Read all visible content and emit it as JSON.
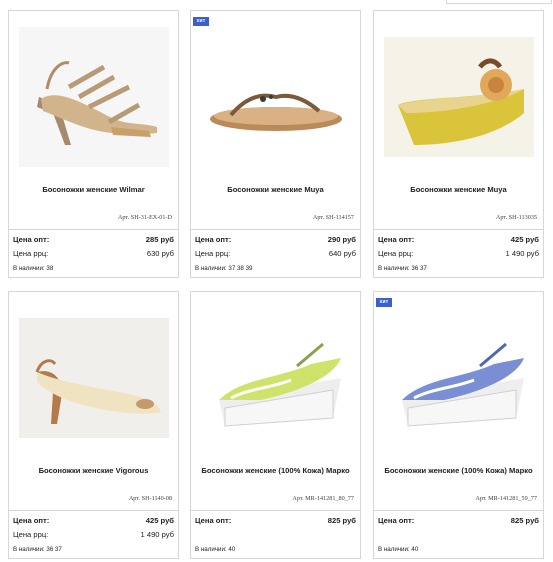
{
  "products": [
    {
      "badge": "",
      "title": "Босоножки женские Wilmar",
      "sku": "Арт. SH-31-EX-01-D",
      "price_opt_label": "Цена опт:",
      "price_opt": "285 руб",
      "price_rrc_label": "Цена ррц:",
      "price_rrc": "630 руб",
      "stock_label": "В наличии:",
      "stock": "38"
    },
    {
      "badge": "хит",
      "title": "Босоножки женские Muya",
      "sku": "Арт. SH-114157",
      "price_opt_label": "Цена опт:",
      "price_opt": "290 руб",
      "price_rrc_label": "Цена ррц:",
      "price_rrc": "640 руб",
      "stock_label": "В наличии:",
      "stock": "37 38 39"
    },
    {
      "badge": "",
      "title": "Босоножки женские Muya",
      "sku": "Арт. SH-113035",
      "price_opt_label": "Цена опт:",
      "price_opt": "425 руб",
      "price_rrc_label": "Цена ррц:",
      "price_rrc": "1 490 руб",
      "stock_label": "В наличии:",
      "stock": "36 37"
    },
    {
      "badge": "",
      "title": "Босоножки женские Vigorous",
      "sku": "Арт. SH-1140-08",
      "price_opt_label": "Цена опт:",
      "price_opt": "425 руб",
      "price_rrc_label": "Цена ррц:",
      "price_rrc": "1 490 руб",
      "stock_label": "В наличии:",
      "stock": "36 37"
    },
    {
      "badge": "",
      "title": "Босоножки женские (100% Кожа) Марко",
      "sku": "Арт. MR-141281_80_77",
      "price_opt_label": "Цена опт:",
      "price_opt": "825 руб",
      "price_rrc_label": "",
      "price_rrc": "",
      "stock_label": "В наличии:",
      "stock": "40"
    },
    {
      "badge": "хит",
      "title": "Босоножки женские (100% Кожа) Марко",
      "sku": "Арт. MR-141281_59_77",
      "price_opt_label": "Цена опт:",
      "price_opt": "825 руб",
      "price_rrc_label": "",
      "price_rrc": "",
      "stock_label": "В наличии:",
      "stock": "40"
    }
  ]
}
